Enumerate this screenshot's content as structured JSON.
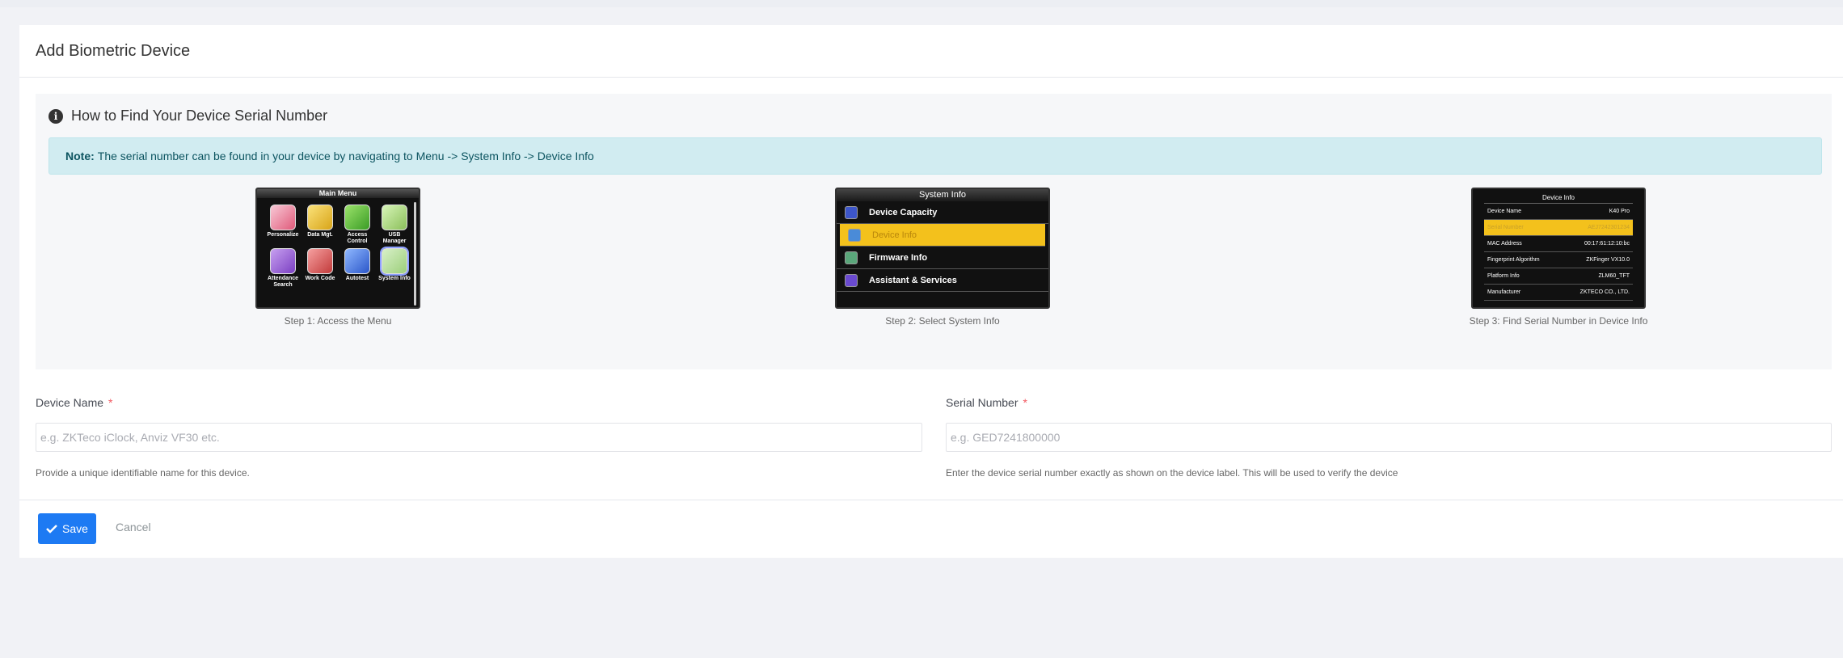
{
  "page": {
    "title": "Add Biometric Device"
  },
  "help": {
    "title": "How to Find Your Device Serial Number",
    "note_prefix": "Note:",
    "note_text": "The serial number can be found in your device by navigating to Menu -> System Info -> Device Info",
    "steps": [
      {
        "caption": "Step 1: Access the Menu",
        "screen_title": "Main Menu",
        "items": [
          "Personalize",
          "Data Mgt.",
          "Access Control",
          "USB Manager",
          "Attendance Search",
          "Work Code",
          "Autotest",
          "System Info"
        ]
      },
      {
        "caption": "Step 2: Select System Info",
        "screen_title": "System Info",
        "items": [
          "Device Capacity",
          "Device Info",
          "Firmware Info",
          "Assistant & Services"
        ],
        "selected": "Device Info"
      },
      {
        "caption": "Step 3: Find Serial Number in Device Info",
        "screen_title": "Device Info",
        "rows": [
          {
            "label": "Device Name",
            "value": "K40 Pro"
          },
          {
            "label": "Serial Number",
            "value": "AEJ7242301234"
          },
          {
            "label": "MAC Address",
            "value": "00:17:61:12:10:bc"
          },
          {
            "label": "Fingerprint Algorithm",
            "value": "ZKFinger VX10.0"
          },
          {
            "label": "Platform Info",
            "value": "ZLM60_TFT"
          },
          {
            "label": "Manufacturer",
            "value": "ZKTECO CO., LTD."
          }
        ]
      }
    ]
  },
  "form": {
    "device_name": {
      "label": "Device Name",
      "required_mark": "*",
      "placeholder": "e.g. ZKTeco iClock, Anviz VF30 etc.",
      "value": "",
      "help": "Provide a unique identifiable name for this device."
    },
    "serial_number": {
      "label": "Serial Number",
      "required_mark": "*",
      "placeholder": "e.g. GED7241800000",
      "value": "",
      "help": "Enter the device serial number exactly as shown on the device label. This will be used to verify the device"
    }
  },
  "actions": {
    "save_label": "Save",
    "cancel_label": "Cancel"
  },
  "colors": {
    "primary": "#1d7af3",
    "note_bg": "#d1ecf1",
    "note_text": "#0c5460",
    "required": "#f25961",
    "highlight": "#f3c11c"
  }
}
